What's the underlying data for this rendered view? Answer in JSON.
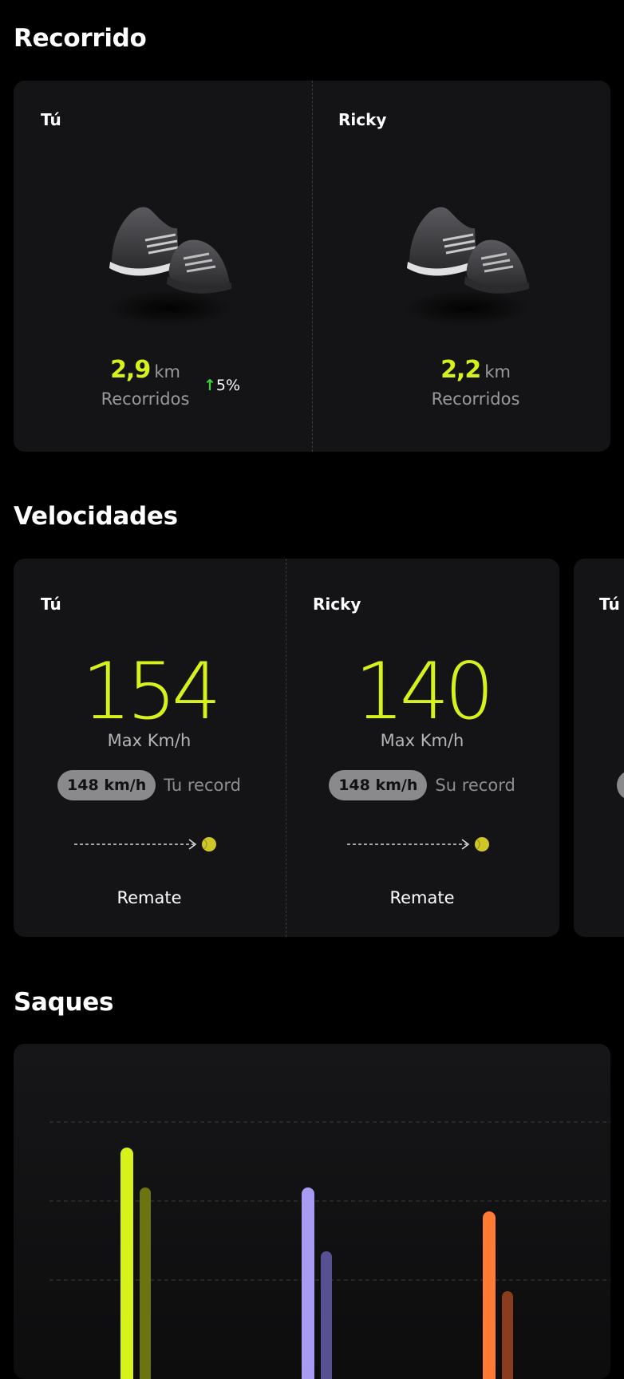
{
  "recorrido": {
    "title": "Recorrido",
    "players": [
      {
        "name": "Tú",
        "value": "2,9",
        "unit": "km",
        "label": "Recorridos",
        "trend": "5%"
      },
      {
        "name": "Ricky",
        "value": "2,2",
        "unit": "km",
        "label": "Recorridos"
      }
    ]
  },
  "velocidades": {
    "title": "Velocidades",
    "players": [
      {
        "name": "Tú",
        "speed": "154",
        "speed_label": "Max Km/h",
        "record_value": "148 km/h",
        "record_label": "Tu record",
        "shot": "Remate"
      },
      {
        "name": "Ricky",
        "speed": "140",
        "speed_label": "Max Km/h",
        "record_value": "148 km/h",
        "record_label": "Su record",
        "shot": "Remate"
      }
    ],
    "next_card_name": "Tú"
  },
  "saques": {
    "title": "Saques"
  },
  "chart_data": {
    "type": "bar",
    "groups": 3,
    "series": [
      {
        "values": [
          290,
          240,
          210
        ]
      },
      {
        "values": [
          240,
          160,
          110
        ]
      }
    ],
    "colors": {
      "primary": [
        "#d7f21a",
        "#a79cf2",
        "#ff7a33"
      ],
      "secondary": [
        "#6b7410",
        "#575191",
        "#8a3d1d"
      ]
    },
    "grid": true
  },
  "colors": {
    "accent": "#d7f21a",
    "trend_up": "#37d43a",
    "card_bg": "#141416"
  },
  "icons": {
    "shoe": "sneaker-image",
    "ball": "tennis-ball-icon",
    "trend": "arrow-up-icon"
  }
}
